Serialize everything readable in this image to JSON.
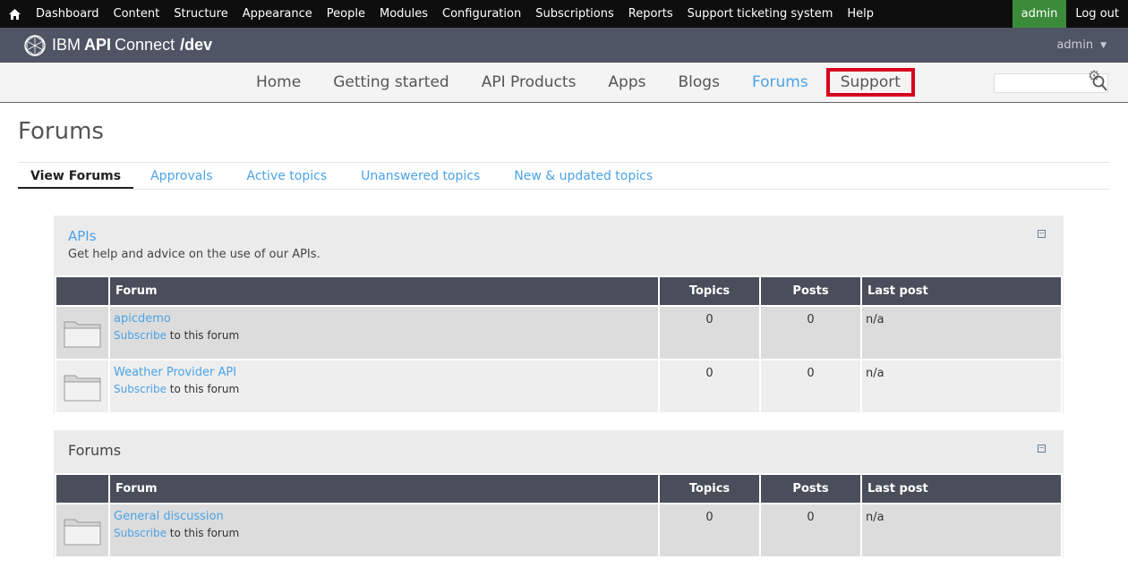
{
  "admin_toolbar": {
    "items": [
      "Dashboard",
      "Content",
      "Structure",
      "Appearance",
      "People",
      "Modules",
      "Configuration",
      "Subscriptions",
      "Reports",
      "Support ticketing system",
      "Help"
    ],
    "user": "admin",
    "logout": "Log out"
  },
  "brand": {
    "ibm": "IBM",
    "api": "API",
    "connect": "Connect",
    "catalog": "/dev",
    "user": "admin"
  },
  "main_nav": {
    "items": [
      "Home",
      "Getting started",
      "API Products",
      "Apps",
      "Blogs",
      "Forums",
      "Support"
    ],
    "active": "Forums",
    "highlighted": "Support"
  },
  "page": {
    "title": "Forums",
    "tabs": [
      "View Forums",
      "Approvals",
      "Active topics",
      "Unanswered topics",
      "New & updated topics"
    ]
  },
  "columns": {
    "forum": "Forum",
    "topics": "Topics",
    "posts": "Posts",
    "last_post": "Last post"
  },
  "sections": [
    {
      "title": "APIs",
      "description": "Get help and advice on the use of our APIs.",
      "forums": [
        {
          "name": "apicdemo",
          "subscribe": "Subscribe",
          "subscribe_suffix": "to this forum",
          "topics": "0",
          "posts": "0",
          "last_post": "n/a"
        },
        {
          "name": "Weather Provider API",
          "subscribe": "Subscribe",
          "subscribe_suffix": "to this forum",
          "topics": "0",
          "posts": "0",
          "last_post": "n/a"
        }
      ]
    },
    {
      "title": "Forums",
      "description": "",
      "forums": [
        {
          "name": "General discussion",
          "subscribe": "Subscribe",
          "subscribe_suffix": "to this forum",
          "topics": "0",
          "posts": "0",
          "last_post": "n/a"
        }
      ]
    }
  ],
  "colors": {
    "admin_bar": "#0e0e0e",
    "brand_bar": "#4f5564",
    "link": "#4ca3e6",
    "highlight": "#d8001b",
    "user_badge": "#3c8b3a"
  }
}
